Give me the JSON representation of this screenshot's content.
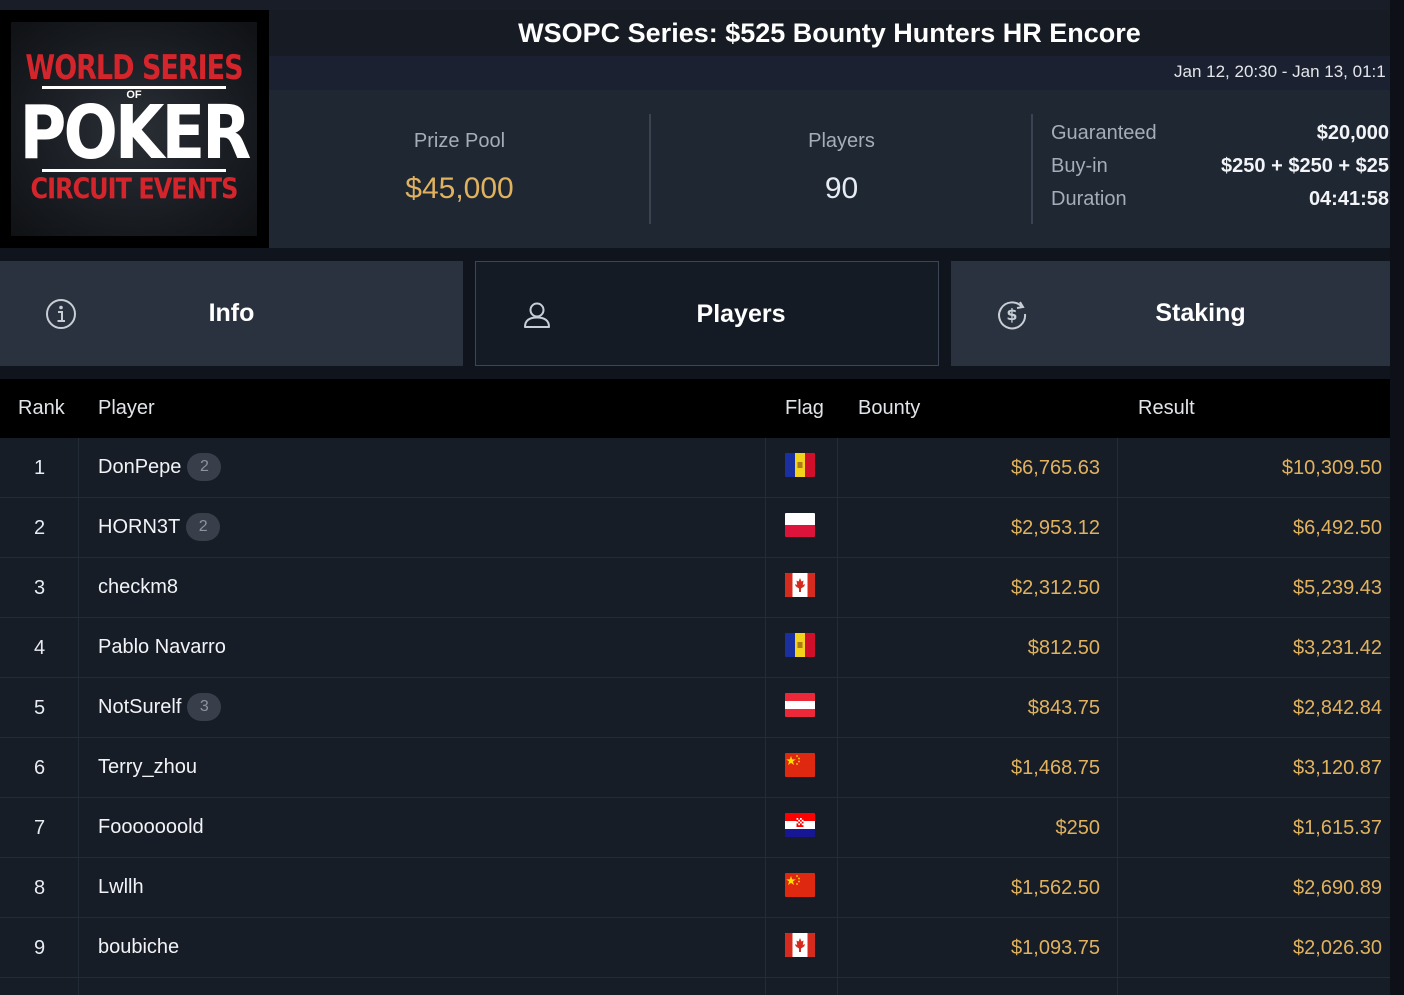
{
  "logo": {
    "line1": "WORLD SERIES",
    "of": "OF",
    "line2": "POKER",
    "line3": "CIRCUIT EVENTS"
  },
  "header": {
    "title": "WSOPC Series: $525 Bounty Hunters HR Encore",
    "dates": "Jan 12, 20:30 - Jan 13, 01:1"
  },
  "stats": {
    "prize_pool_label": "Prize Pool",
    "prize_pool_value": "$45,000",
    "players_label": "Players",
    "players_value": "90",
    "details": [
      {
        "label": "Guaranteed",
        "value": "$20,000"
      },
      {
        "label": "Buy-in",
        "value": "$250 + $250 + $25"
      },
      {
        "label": "Duration",
        "value": "04:41:58"
      }
    ]
  },
  "tabs": [
    {
      "label": "Info",
      "icon": "info-circle-icon",
      "active": false
    },
    {
      "label": "Players",
      "icon": "user-icon",
      "active": true
    },
    {
      "label": "Staking",
      "icon": "dollar-cycle-icon",
      "active": false
    }
  ],
  "table": {
    "headers": {
      "rank": "Rank",
      "player": "Player",
      "flag": "Flag",
      "bounty": "Bounty",
      "result": "Result"
    },
    "rows": [
      {
        "rank": "1",
        "player": "DonPepe",
        "badge": "2",
        "flag": "andorra",
        "bounty": "$6,765.63",
        "result": "$10,309.50"
      },
      {
        "rank": "2",
        "player": "HORN3T",
        "badge": "2",
        "flag": "poland",
        "bounty": "$2,953.12",
        "result": "$6,492.50"
      },
      {
        "rank": "3",
        "player": "checkm8",
        "badge": "",
        "flag": "canada",
        "bounty": "$2,312.50",
        "result": "$5,239.43"
      },
      {
        "rank": "4",
        "player": "Pablo Navarro",
        "badge": "",
        "flag": "andorra",
        "bounty": "$812.50",
        "result": "$3,231.42"
      },
      {
        "rank": "5",
        "player": "NotSurelf",
        "badge": "3",
        "flag": "austria",
        "bounty": "$843.75",
        "result": "$2,842.84"
      },
      {
        "rank": "6",
        "player": "Terry_zhou",
        "badge": "",
        "flag": "china",
        "bounty": "$1,468.75",
        "result": "$3,120.87"
      },
      {
        "rank": "7",
        "player": "Fooooooold",
        "badge": "",
        "flag": "croatia",
        "bounty": "$250",
        "result": "$1,615.37"
      },
      {
        "rank": "8",
        "player": "Lwllh",
        "badge": "",
        "flag": "china",
        "bounty": "$1,562.50",
        "result": "$2,690.89"
      },
      {
        "rank": "9",
        "player": "boubiche",
        "badge": "",
        "flag": "canada",
        "bounty": "$1,093.75",
        "result": "$2,026.30"
      }
    ]
  },
  "colors": {
    "gold": "#e0b25e",
    "background": "#171d27",
    "header_black": "#000000"
  }
}
